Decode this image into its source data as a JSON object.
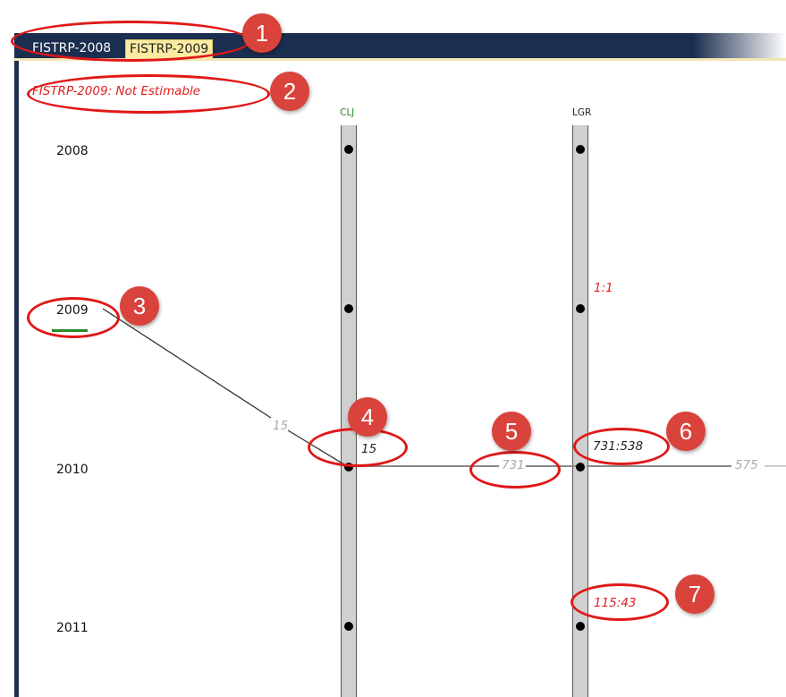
{
  "tabs": [
    {
      "label": "FISTRP-2008",
      "active": false
    },
    {
      "label": "FISTRP-2009",
      "active": true
    }
  ],
  "status_message": "FISTRP-2009: Not Estimable",
  "years": [
    "2008",
    "2009",
    "2010",
    "2011"
  ],
  "columns": [
    {
      "label": "CLJ",
      "color": "#2a8a2a"
    },
    {
      "label": "LGR",
      "color": "#222222"
    }
  ],
  "edge_labels": {
    "year_to_clj": "15",
    "clj_count": "15",
    "clj_to_lgr": "731",
    "lgr_ratio_2010": "731:538",
    "lgr_outgoing": "575",
    "lgr_ratio_2009": "1:1",
    "lgr_ratio_2011": "115:43"
  },
  "callouts": [
    "1",
    "2",
    "3",
    "4",
    "5",
    "6",
    "7"
  ],
  "colors": {
    "navy": "#1c2e4f",
    "callout_red": "#d9433b",
    "ring_red": "#e01818",
    "estimate_red": "#e02020",
    "active_tab": "#fbeba0"
  }
}
